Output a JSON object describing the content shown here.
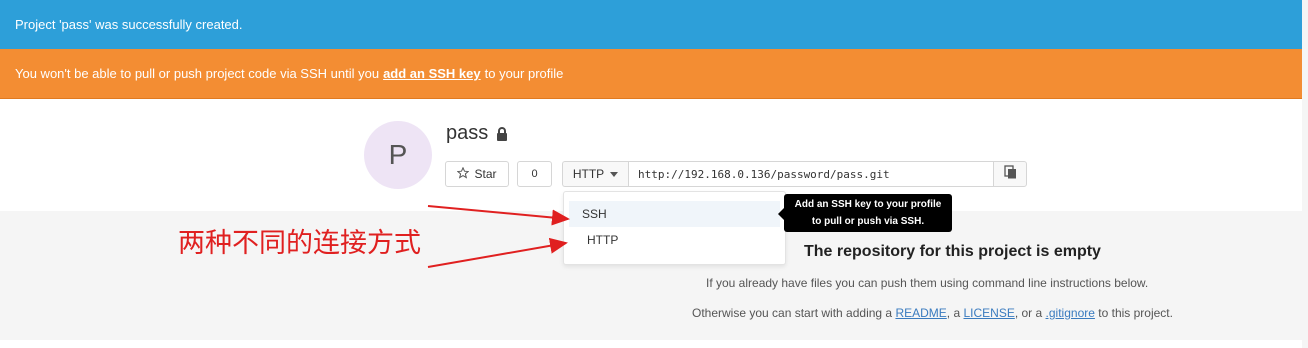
{
  "flash_notice": {
    "text": "Project 'pass' was successfully created."
  },
  "flash_alert": {
    "prefix": "You won't be able to pull or push project code via SSH until you",
    "link": "add an SSH key",
    "suffix": "to your profile"
  },
  "project": {
    "avatar_letter": "P",
    "name": "pass",
    "star_label": "Star",
    "star_count": "0",
    "protocol": "HTTP",
    "clone_url": "http://192.168.0.136/password/pass.git"
  },
  "dropdown": {
    "items": [
      {
        "label": "SSH"
      },
      {
        "label": "HTTP"
      }
    ]
  },
  "tooltip": {
    "line1": "Add an SSH key to your profile",
    "line2": "to pull or push via SSH."
  },
  "empty": {
    "title": "The repository for this project is empty",
    "line1": "If you already have files you can push them using command line instructions below.",
    "line2_prefix": "Otherwise you can start with adding a",
    "readme": "README",
    "sep1": ", a",
    "license": "LICENSE",
    "sep2": ", or a",
    "gitignore": ".gitignore",
    "line2_suffix": "to this project."
  },
  "annotation": {
    "text": "两种不同的连接方式",
    "color": "#e02020"
  },
  "colors": {
    "notice": "#2d9fd9",
    "alert": "#f38d33",
    "link": "#3a7bbf"
  }
}
